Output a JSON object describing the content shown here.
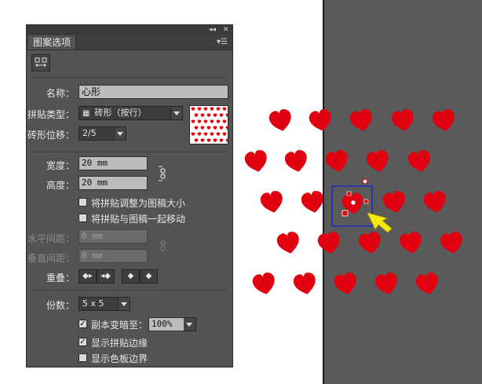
{
  "colors": {
    "heart": "#e0000f",
    "artboard_bg": "#5a5a5a",
    "selection_box": "#0b1fd8",
    "annotation_arrow_red": "#e3242b",
    "annotation_arrow_yellow": "#f2ea0d"
  },
  "panel": {
    "tab_title": "图案选项",
    "controls": {
      "collapse_icon": "double-chevron-icon",
      "close_icon": "close-icon",
      "menu_icon": "panel-menu-icon",
      "tile_tool_icon": "pattern-tile-tool-icon"
    },
    "name_label": "名称：",
    "name_value": "心形",
    "tile_type_label": "拼贴类型：",
    "tile_type_value": "砖形（按行）",
    "brick_offset_label": "砖形位移：",
    "brick_offset_value": "2/5",
    "width_label": "宽度：",
    "width_value": "20 mm",
    "height_label": "高度：",
    "height_value": "20 mm",
    "fit_tile_label": "将拼贴调整为图稿大小",
    "move_with_art_label": "将拼贴与图稿一起移动",
    "h_spacing_label": "水平间距：",
    "h_spacing_value": "0 mm",
    "v_spacing_label": "垂直间距：",
    "v_spacing_value": "0 mm",
    "overlap_label": "重叠：",
    "copies_label": "份数：",
    "copies_value": "5 x 5",
    "dim_copies_label": "副本变暗至：",
    "dim_copies_value": "100%",
    "show_tile_edge_label": "显示拼贴边缘",
    "show_swatch_bounds_label": "显示色板边界",
    "checkboxes": {
      "fit_tile": false,
      "move_with_art": false,
      "dim_copies": true,
      "show_tile_edge": true,
      "show_swatch_bounds": false
    }
  }
}
